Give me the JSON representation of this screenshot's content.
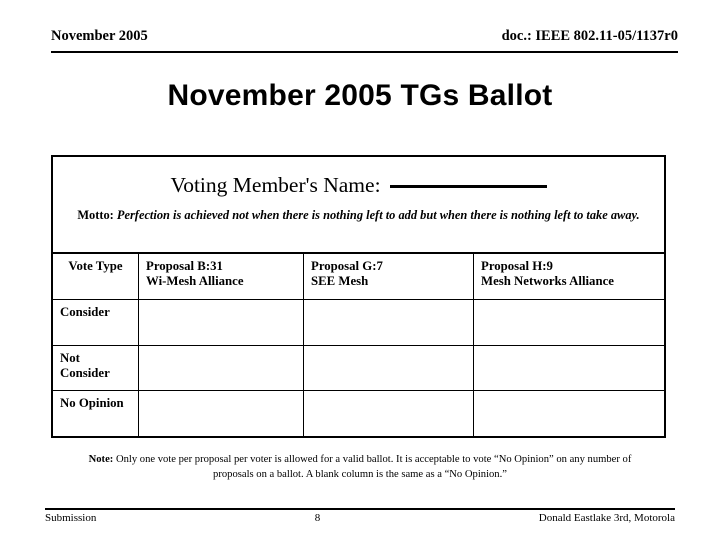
{
  "header": {
    "left": "November 2005",
    "right": "doc.: IEEE 802.11-05/1137r0"
  },
  "title": "November 2005 TGs Ballot",
  "ballot": {
    "voting_member_label": "Voting Member's Name:",
    "voting_member_value": "",
    "motto_label": "Motto:",
    "motto_text": "Perfection is achieved not when there is nothing left to add but when there is nothing left to take away.",
    "columns": [
      {
        "line1": "Vote Type",
        "line2": ""
      },
      {
        "line1": "Proposal B:31",
        "line2": "Wi-Mesh Alliance"
      },
      {
        "line1": "Proposal G:7",
        "line2": "SEE Mesh"
      },
      {
        "line1": "Proposal H:9",
        "line2": "Mesh Networks Alliance"
      }
    ],
    "rows": [
      {
        "label_line1": "Consider",
        "label_line2": "",
        "b": "",
        "g": "",
        "h": ""
      },
      {
        "label_line1": "Not",
        "label_line2": "Consider",
        "b": "",
        "g": "",
        "h": ""
      },
      {
        "label_line1": "No Opinion",
        "label_line2": "",
        "b": "",
        "g": "",
        "h": ""
      }
    ],
    "note_label": "Note:",
    "note_text": "Only one vote per proposal per voter is allowed for a valid ballot. It is acceptable to vote “No Opinion” on any number of proposals on a ballot. A blank column is the same as a “No Opinion.”"
  },
  "footer": {
    "left": "Submission",
    "page": "8",
    "right": "Donald Eastlake 3rd, Motorola"
  }
}
